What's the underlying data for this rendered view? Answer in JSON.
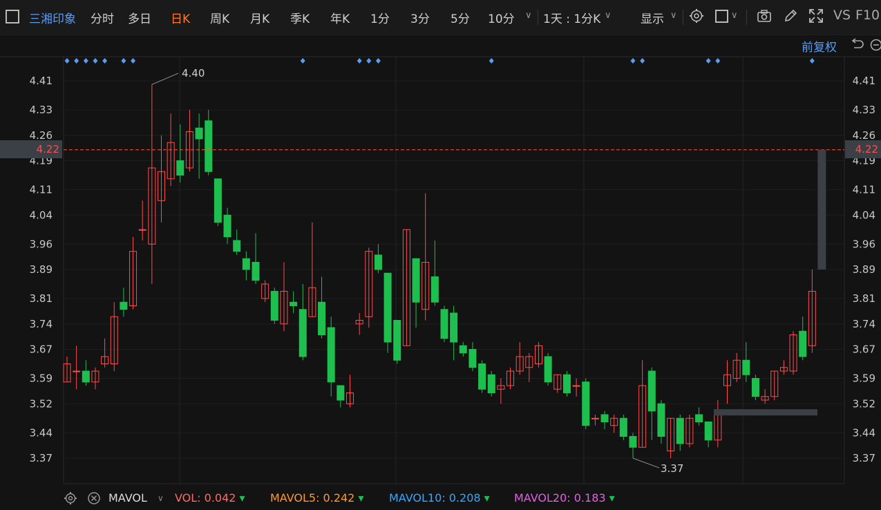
{
  "toolbar": {
    "stock_name": "三湘印象",
    "periods": [
      "分时",
      "多日",
      "日K",
      "周K",
      "月K",
      "季K",
      "年K",
      "1分",
      "3分",
      "5分",
      "10分"
    ],
    "active_period": "日K",
    "combo": "1天 : 1分K",
    "display": "显示",
    "vs": "VS",
    "f10": "F10"
  },
  "restore_label": "前复权",
  "price_axis": {
    "ticks": [
      "4.41",
      "4.33",
      "4.26",
      "4.19",
      "4.11",
      "4.04",
      "3.96",
      "3.89",
      "3.81",
      "3.74",
      "3.67",
      "3.59",
      "3.52",
      "3.44",
      "3.37"
    ],
    "current": "4.22",
    "high_label": "4.40",
    "low_label": "3.37"
  },
  "colors": {
    "up": "#ff4d4d",
    "down": "#1fbf4f",
    "active": "#ff7a2a",
    "accent": "#5b9bf0",
    "dash": "#ff5a3c"
  },
  "chart_data": {
    "type": "candlestick",
    "ylim": [
      3.34,
      4.46
    ],
    "candles": [
      {
        "o": 3.58,
        "c": 3.63,
        "h": 3.65,
        "l": 3.58
      },
      {
        "o": 3.61,
        "c": 3.61,
        "h": 3.68,
        "l": 3.56
      },
      {
        "o": 3.61,
        "c": 3.58,
        "h": 3.64,
        "l": 3.57
      },
      {
        "o": 3.58,
        "c": 3.61,
        "h": 3.62,
        "l": 3.56
      },
      {
        "o": 3.63,
        "c": 3.65,
        "h": 3.7,
        "l": 3.62
      },
      {
        "o": 3.63,
        "c": 3.76,
        "h": 3.8,
        "l": 3.61
      },
      {
        "o": 3.8,
        "c": 3.78,
        "h": 3.84,
        "l": 3.76
      },
      {
        "o": 3.79,
        "c": 3.94,
        "h": 3.98,
        "l": 3.78
      },
      {
        "o": 4.0,
        "c": 4.0,
        "h": 4.08,
        "l": 3.97
      },
      {
        "o": 3.96,
        "c": 4.17,
        "h": 4.4,
        "l": 3.85
      },
      {
        "o": 4.08,
        "c": 4.16,
        "h": 4.26,
        "l": 4.02
      },
      {
        "o": 4.14,
        "c": 4.24,
        "h": 4.32,
        "l": 4.12
      },
      {
        "o": 4.19,
        "c": 4.15,
        "h": 4.29,
        "l": 4.13
      },
      {
        "o": 4.17,
        "c": 4.27,
        "h": 4.33,
        "l": 4.16
      },
      {
        "o": 4.28,
        "c": 4.25,
        "h": 4.32,
        "l": 4.14
      },
      {
        "o": 4.3,
        "c": 4.16,
        "h": 4.33,
        "l": 4.15
      },
      {
        "o": 4.14,
        "c": 4.02,
        "h": 4.14,
        "l": 4.01
      },
      {
        "o": 4.04,
        "c": 3.98,
        "h": 4.06,
        "l": 3.96
      },
      {
        "o": 3.97,
        "c": 3.94,
        "h": 4.0,
        "l": 3.93
      },
      {
        "o": 3.92,
        "c": 3.89,
        "h": 3.94,
        "l": 3.86
      },
      {
        "o": 3.91,
        "c": 3.86,
        "h": 3.99,
        "l": 3.85
      },
      {
        "o": 3.81,
        "c": 3.85,
        "h": 3.86,
        "l": 3.8
      },
      {
        "o": 3.83,
        "c": 3.75,
        "h": 3.84,
        "l": 3.74
      },
      {
        "o": 3.74,
        "c": 3.83,
        "h": 3.91,
        "l": 3.72
      },
      {
        "o": 3.8,
        "c": 3.79,
        "h": 3.83,
        "l": 3.77
      },
      {
        "o": 3.78,
        "c": 3.65,
        "h": 3.85,
        "l": 3.64
      },
      {
        "o": 3.76,
        "c": 3.84,
        "h": 4.02,
        "l": 3.76
      },
      {
        "o": 3.8,
        "c": 3.71,
        "h": 3.87,
        "l": 3.7
      },
      {
        "o": 3.73,
        "c": 3.58,
        "h": 3.76,
        "l": 3.54
      },
      {
        "o": 3.57,
        "c": 3.53,
        "h": 3.57,
        "l": 3.51
      },
      {
        "o": 3.52,
        "c": 3.55,
        "h": 3.6,
        "l": 3.51
      },
      {
        "o": 3.74,
        "c": 3.75,
        "h": 3.77,
        "l": 3.71
      },
      {
        "o": 3.76,
        "c": 3.94,
        "h": 3.95,
        "l": 3.73
      },
      {
        "o": 3.93,
        "c": 3.89,
        "h": 3.96,
        "l": 3.88
      },
      {
        "o": 3.88,
        "c": 3.69,
        "h": 3.88,
        "l": 3.66
      },
      {
        "o": 3.75,
        "c": 3.64,
        "h": 3.75,
        "l": 3.63
      },
      {
        "o": 3.68,
        "c": 4.0,
        "h": 4.0,
        "l": 3.68
      },
      {
        "o": 3.92,
        "c": 3.8,
        "h": 3.92,
        "l": 3.73
      },
      {
        "o": 3.78,
        "c": 3.91,
        "h": 4.1,
        "l": 3.75
      },
      {
        "o": 3.87,
        "c": 3.8,
        "h": 3.97,
        "l": 3.79
      },
      {
        "o": 3.78,
        "c": 3.7,
        "h": 3.79,
        "l": 3.69
      },
      {
        "o": 3.77,
        "c": 3.69,
        "h": 3.79,
        "l": 3.64
      },
      {
        "o": 3.68,
        "c": 3.66,
        "h": 3.69,
        "l": 3.65
      },
      {
        "o": 3.67,
        "c": 3.62,
        "h": 3.69,
        "l": 3.61
      },
      {
        "o": 3.63,
        "c": 3.56,
        "h": 3.64,
        "l": 3.55
      },
      {
        "o": 3.6,
        "c": 3.55,
        "h": 3.61,
        "l": 3.54
      },
      {
        "o": 3.56,
        "c": 3.57,
        "h": 3.59,
        "l": 3.52
      },
      {
        "o": 3.57,
        "c": 3.61,
        "h": 3.62,
        "l": 3.56
      },
      {
        "o": 3.61,
        "c": 3.65,
        "h": 3.69,
        "l": 3.6
      },
      {
        "o": 3.62,
        "c": 3.65,
        "h": 3.66,
        "l": 3.58
      },
      {
        "o": 3.63,
        "c": 3.68,
        "h": 3.69,
        "l": 3.62
      },
      {
        "o": 3.65,
        "c": 3.58,
        "h": 3.66,
        "l": 3.57
      },
      {
        "o": 3.56,
        "c": 3.6,
        "h": 3.6,
        "l": 3.55
      },
      {
        "o": 3.6,
        "c": 3.55,
        "h": 3.61,
        "l": 3.54
      },
      {
        "o": 3.57,
        "c": 3.57,
        "h": 3.59,
        "l": 3.54
      },
      {
        "o": 3.58,
        "c": 3.46,
        "h": 3.59,
        "l": 3.45
      },
      {
        "o": 3.48,
        "c": 3.48,
        "h": 3.49,
        "l": 3.46
      },
      {
        "o": 3.49,
        "c": 3.47,
        "h": 3.5,
        "l": 3.45
      },
      {
        "o": 3.46,
        "c": 3.48,
        "h": 3.49,
        "l": 3.44
      },
      {
        "o": 3.48,
        "c": 3.43,
        "h": 3.49,
        "l": 3.42
      },
      {
        "o": 3.43,
        "c": 3.4,
        "h": 3.44,
        "l": 3.37
      },
      {
        "o": 3.4,
        "c": 3.57,
        "h": 3.64,
        "l": 3.4
      },
      {
        "o": 3.61,
        "c": 3.5,
        "h": 3.62,
        "l": 3.42
      },
      {
        "o": 3.52,
        "c": 3.43,
        "h": 3.53,
        "l": 3.41
      },
      {
        "o": 3.39,
        "c": 3.48,
        "h": 3.48,
        "l": 3.37
      },
      {
        "o": 3.48,
        "c": 3.41,
        "h": 3.49,
        "l": 3.39
      },
      {
        "o": 3.41,
        "c": 3.48,
        "h": 3.49,
        "l": 3.4
      },
      {
        "o": 3.49,
        "c": 3.47,
        "h": 3.51,
        "l": 3.46
      },
      {
        "o": 3.47,
        "c": 3.42,
        "h": 3.47,
        "l": 3.4
      },
      {
        "o": 3.42,
        "c": 3.49,
        "h": 3.53,
        "l": 3.4
      },
      {
        "o": 3.57,
        "c": 3.6,
        "h": 3.64,
        "l": 3.52
      },
      {
        "o": 3.59,
        "c": 3.64,
        "h": 3.66,
        "l": 3.58
      },
      {
        "o": 3.64,
        "c": 3.6,
        "h": 3.69,
        "l": 3.58
      },
      {
        "o": 3.59,
        "c": 3.54,
        "h": 3.6,
        "l": 3.53
      },
      {
        "o": 3.53,
        "c": 3.54,
        "h": 3.56,
        "l": 3.52
      },
      {
        "o": 3.54,
        "c": 3.61,
        "h": 3.61,
        "l": 3.53
      },
      {
        "o": 3.61,
        "c": 3.62,
        "h": 3.64,
        "l": 3.6
      },
      {
        "o": 3.61,
        "c": 3.71,
        "h": 3.72,
        "l": 3.6
      },
      {
        "o": 3.72,
        "c": 3.65,
        "h": 3.76,
        "l": 3.64
      },
      {
        "o": 3.68,
        "c": 3.83,
        "h": 3.89,
        "l": 3.66
      }
    ],
    "current_price": 4.22,
    "high": 4.4,
    "low": 3.37,
    "markers_count": 17
  },
  "volume_panel": {
    "indicator": "MAVOL",
    "items": [
      {
        "label": "VOL:",
        "value": "0.042",
        "color": "#ff6b6b"
      },
      {
        "label": "MAVOL5:",
        "value": "0.242",
        "color": "#ff9a2a"
      },
      {
        "label": "MAVOL10:",
        "value": "0.208",
        "color": "#36a7ff"
      },
      {
        "label": "MAVOL20:",
        "value": "0.183",
        "color": "#e062e0"
      }
    ]
  }
}
